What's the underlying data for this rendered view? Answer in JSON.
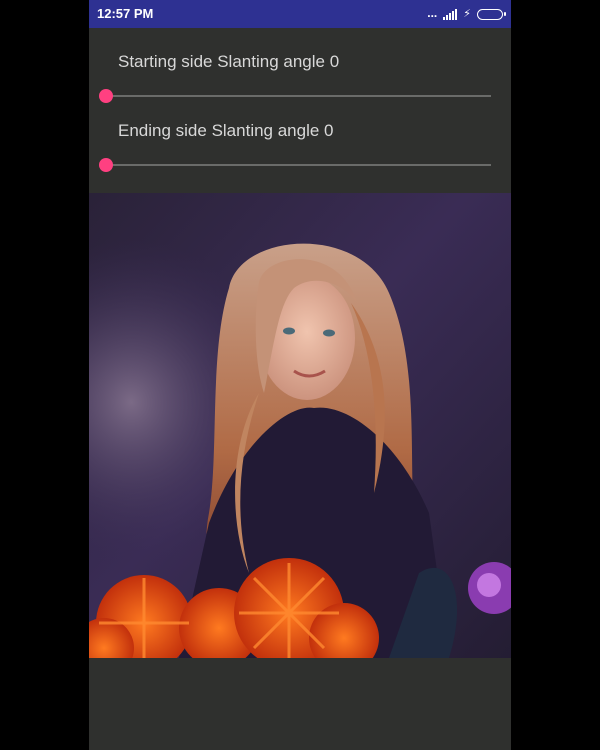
{
  "status_bar": {
    "time": "12:57 PM",
    "signal_dots": "...",
    "charging_glyph": "⚡",
    "battery_level": 1.0,
    "background_color": "#2e3192",
    "battery_color": "#5fe03a"
  },
  "controls": {
    "start_angle": {
      "label": "Starting side Slanting angle 0",
      "value": 0,
      "max": 100
    },
    "end_angle": {
      "label": "Ending side Slanting angle 0",
      "value": 0,
      "max": 100
    }
  },
  "theme": {
    "accent": "#ff4081",
    "background": "#2f302e"
  },
  "image": {
    "icon": "photo-girl-with-flowers"
  }
}
